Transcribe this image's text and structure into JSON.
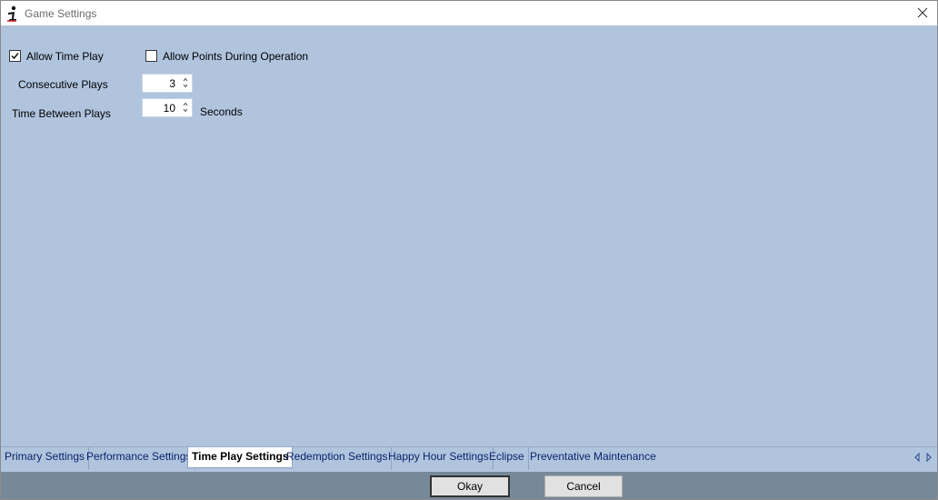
{
  "window": {
    "title": "Game Settings"
  },
  "settings": {
    "allow_time_play": {
      "label": "Allow Time Play",
      "checked": true
    },
    "allow_points": {
      "label": "Allow Points During Operation",
      "checked": false
    },
    "consecutive_plays": {
      "label": "Consecutive Plays",
      "value": "3"
    },
    "time_between_plays": {
      "label": "Time Between Plays",
      "value": "10",
      "unit": "Seconds"
    }
  },
  "tabs": [
    {
      "label": "Primary Settings"
    },
    {
      "label": "Performance Settings"
    },
    {
      "label": "Time Play Settings",
      "active": true
    },
    {
      "label": "Redemption Settings"
    },
    {
      "label": "Happy Hour Settings"
    },
    {
      "label": "Eclipse"
    },
    {
      "label": "Preventative Maintenance"
    }
  ],
  "footer": {
    "okay_label": "Okay",
    "cancel_label": "Cancel"
  },
  "colors": {
    "client_bg": "#b0c4de",
    "footer_bg": "#778899"
  }
}
